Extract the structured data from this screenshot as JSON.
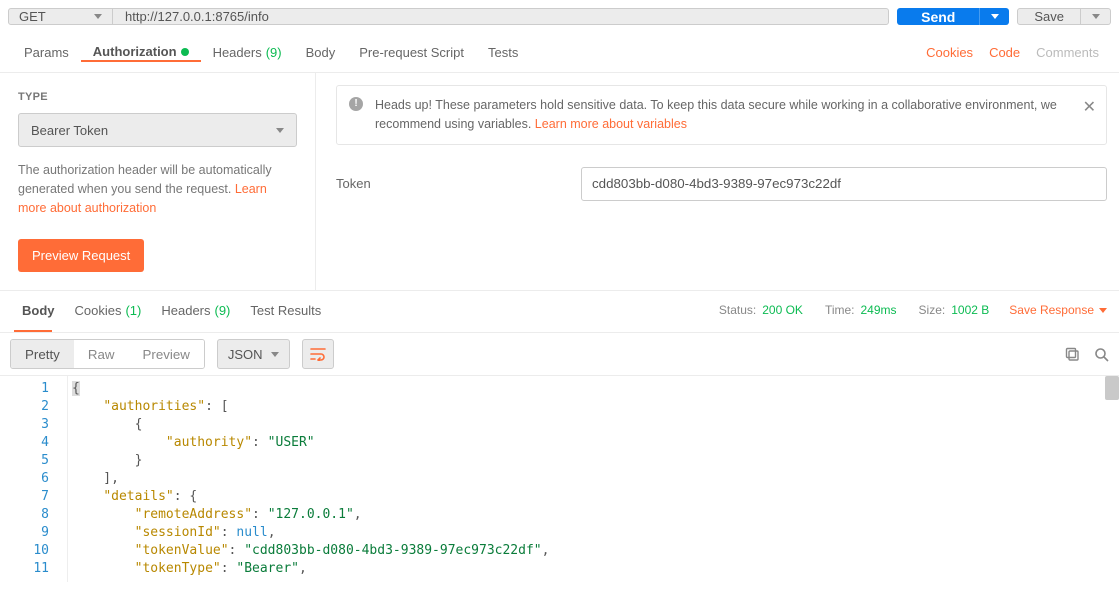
{
  "request": {
    "method": "GET",
    "url": "http://127.0.0.1:8765/info",
    "send_label": "Send",
    "save_label": "Save"
  },
  "reqTabs": {
    "params": "Params",
    "authorization": "Authorization",
    "headers": "Headers",
    "headers_count": "(9)",
    "body": "Body",
    "prerequest": "Pre-request Script",
    "tests": "Tests",
    "cookies": "Cookies",
    "code": "Code",
    "comments": "Comments"
  },
  "auth": {
    "type_label": "TYPE",
    "type_value": "Bearer Token",
    "help1": "The authorization header will be automatically generated when you send the request. ",
    "help_link": "Learn more about authorization",
    "preview_label": "Preview Request",
    "alert_text": "Heads up! These parameters hold sensitive data. To keep this data secure while working in a collaborative environment, we recommend using variables. ",
    "alert_link": "Learn more about variables",
    "token_label": "Token",
    "token_value": "cdd803bb-d080-4bd3-9389-97ec973c22df"
  },
  "resp": {
    "body": "Body",
    "cookies": "Cookies",
    "cookies_count": "(1)",
    "headers": "Headers",
    "headers_count": "(9)",
    "test_results": "Test Results",
    "status_k": "Status:",
    "status_v": "200 OK",
    "time_k": "Time:",
    "time_v": "249ms",
    "size_k": "Size:",
    "size_v": "1002 B",
    "save_response": "Save Response"
  },
  "fmt": {
    "pretty": "Pretty",
    "raw": "Raw",
    "preview": "Preview",
    "lang": "JSON"
  },
  "code_lines": [
    [
      [
        "punc",
        "{"
      ]
    ],
    [
      [
        "punc",
        "    "
      ],
      [
        "key",
        "\"authorities\""
      ],
      [
        "punc",
        ": ["
      ]
    ],
    [
      [
        "punc",
        "        {"
      ]
    ],
    [
      [
        "punc",
        "            "
      ],
      [
        "key",
        "\"authority\""
      ],
      [
        "punc",
        ": "
      ],
      [
        "str",
        "\"USER\""
      ]
    ],
    [
      [
        "punc",
        "        }"
      ]
    ],
    [
      [
        "punc",
        "    ],"
      ]
    ],
    [
      [
        "punc",
        "    "
      ],
      [
        "key",
        "\"details\""
      ],
      [
        "punc",
        ": {"
      ]
    ],
    [
      [
        "punc",
        "        "
      ],
      [
        "key",
        "\"remoteAddress\""
      ],
      [
        "punc",
        ": "
      ],
      [
        "str",
        "\"127.0.0.1\""
      ],
      [
        "punc",
        ","
      ]
    ],
    [
      [
        "punc",
        "        "
      ],
      [
        "key",
        "\"sessionId\""
      ],
      [
        "punc",
        ": "
      ],
      [
        "null",
        "null"
      ],
      [
        "punc",
        ","
      ]
    ],
    [
      [
        "punc",
        "        "
      ],
      [
        "key",
        "\"tokenValue\""
      ],
      [
        "punc",
        ": "
      ],
      [
        "str",
        "\"cdd803bb-d080-4bd3-9389-97ec973c22df\""
      ],
      [
        "punc",
        ","
      ]
    ],
    [
      [
        "punc",
        "        "
      ],
      [
        "key",
        "\"tokenType\""
      ],
      [
        "punc",
        ": "
      ],
      [
        "str",
        "\"Bearer\""
      ],
      [
        "punc",
        ","
      ]
    ]
  ]
}
